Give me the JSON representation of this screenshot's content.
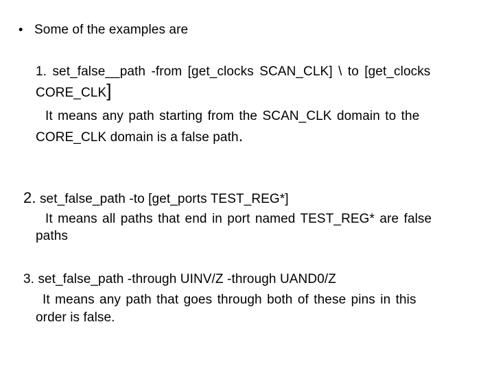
{
  "slide": {
    "intro_bullet": "•",
    "intro_text": "Some of the examples are",
    "examples": [
      {
        "number": "1.",
        "command_line1": "set_false__path  -from  [get_clocks  SCAN_CLK]  \\  to  [get_clocks",
        "command_line2": "CORE_CLK",
        "command_line2_bracket": "]",
        "explanation_line1": "It means any path starting from the SCAN_CLK domain to the",
        "explanation_line2": "CORE_CLK domain is a false path",
        "explanation_line2_end": "."
      },
      {
        "number": "2.",
        "command": "set_false_path -to [get_ports TEST_REG*]",
        "explanation_line1": "It means all paths that end in port named TEST_REG* are false",
        "explanation_line2": "paths"
      },
      {
        "number": "3.",
        "command": "set_false_path -through UINV/Z -through UAND0/Z",
        "explanation_line1": "It means any path that goes through both of these pins in this",
        "explanation_line2": "order is false."
      }
    ]
  }
}
